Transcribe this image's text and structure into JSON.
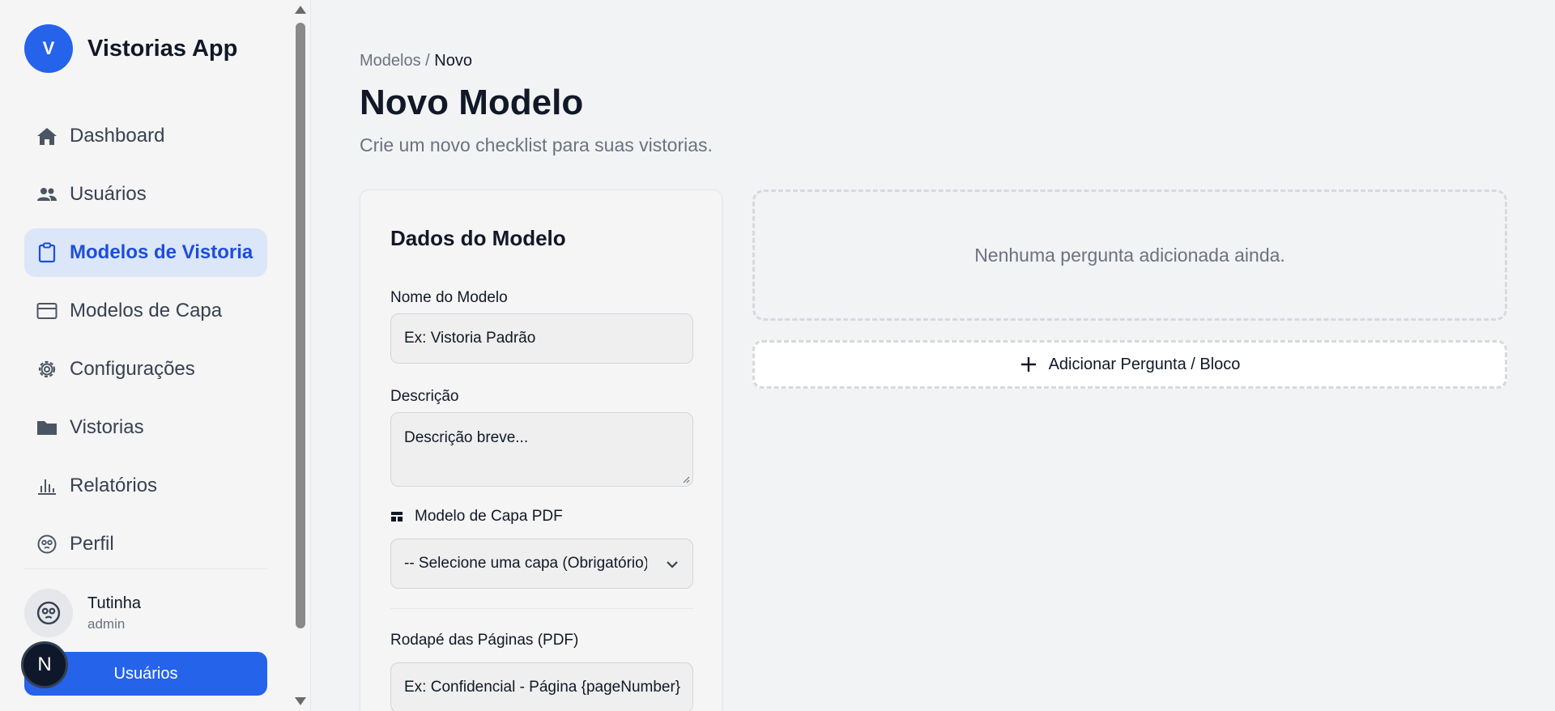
{
  "brand": {
    "logo_letter": "V",
    "name": "Vistorias App"
  },
  "sidebar": {
    "items": [
      {
        "label": "Dashboard",
        "icon": "home-icon"
      },
      {
        "label": "Usuários",
        "icon": "users-icon"
      },
      {
        "label": "Modelos de Vistoria",
        "icon": "clipboard-icon",
        "active": true
      },
      {
        "label": "Modelos de Capa",
        "icon": "layout-icon"
      },
      {
        "label": "Configurações",
        "icon": "gear-icon"
      },
      {
        "label": "Vistorias",
        "icon": "folder-icon"
      },
      {
        "label": "Relatórios",
        "icon": "bar-chart-icon"
      },
      {
        "label": "Perfil",
        "icon": "face-icon"
      }
    ],
    "user": {
      "name": "Tutinha",
      "role": "admin"
    },
    "bottom_button": "Usuários",
    "badge_letter": "N"
  },
  "breadcrumb": {
    "parent": "Modelos",
    "separator": "/",
    "current": "Novo"
  },
  "page": {
    "title": "Novo Modelo",
    "subtitle": "Crie um novo checklist para suas vistorias."
  },
  "form": {
    "title": "Dados do Modelo",
    "name_label": "Nome do Modelo",
    "name_placeholder": "Ex: Vistoria Padrão",
    "description_label": "Descrição",
    "description_placeholder": "Descrição breve...",
    "cover_label": "Modelo de Capa PDF",
    "cover_selected": "-- Selecione uma capa (Obrigatório) --",
    "footer_label": "Rodapé das Páginas (PDF)",
    "footer_placeholder": "Ex: Confidencial - Página {pageNumber}"
  },
  "questions": {
    "empty_text": "Nenhuma pergunta adicionada ainda.",
    "add_button": "Adicionar Pergunta / Bloco"
  },
  "colors": {
    "accent": "#2563eb",
    "active_bg": "#dbe6f8",
    "active_text": "#1d4ed8"
  }
}
